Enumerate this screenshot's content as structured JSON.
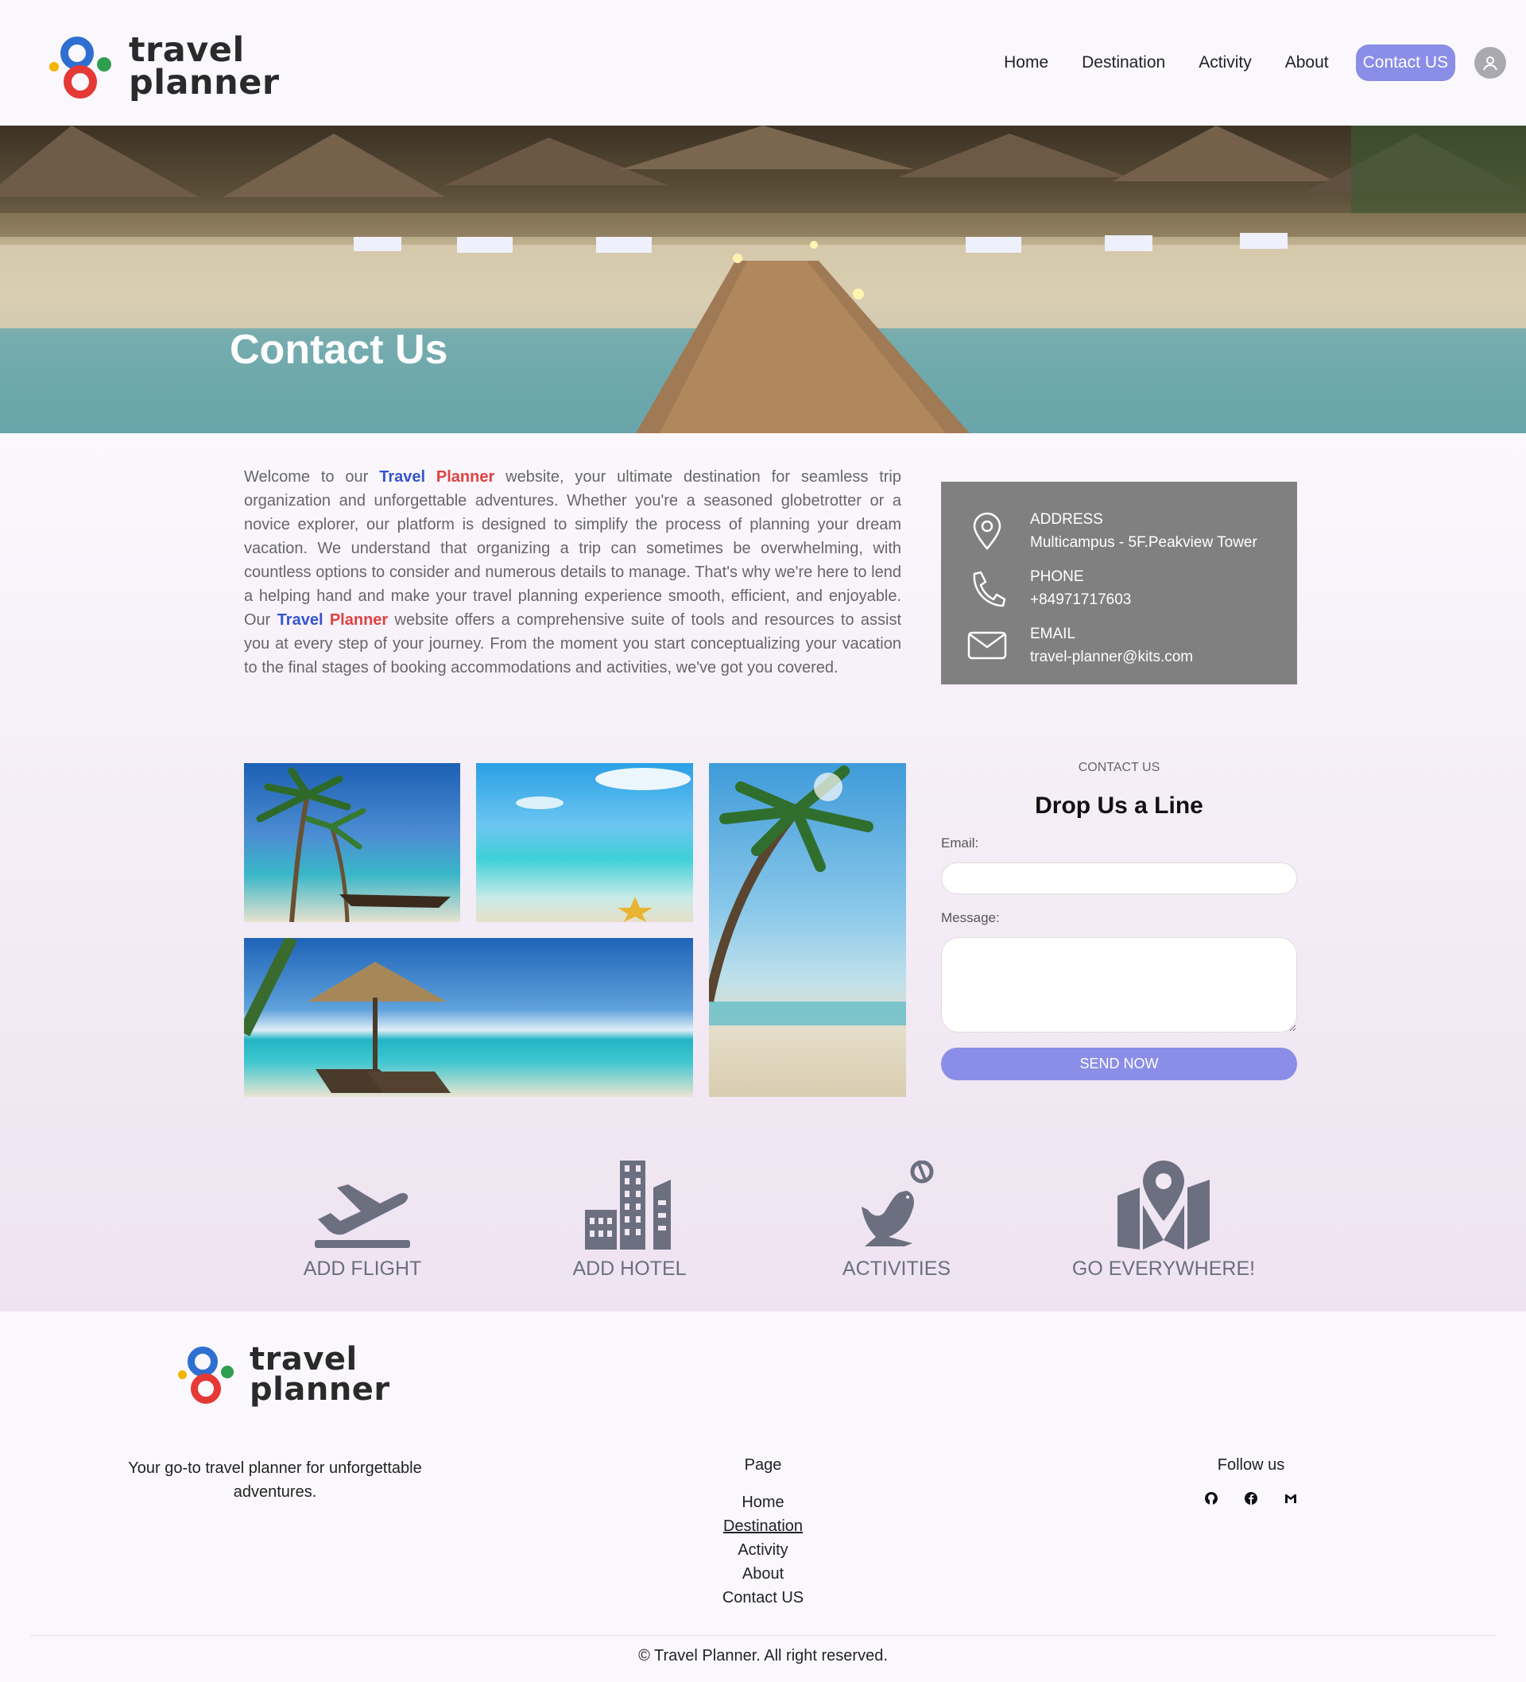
{
  "header": {
    "logo_line1": "travel",
    "logo_line2": "planner",
    "nav": [
      "Home",
      "Destination",
      "Activity",
      "About"
    ],
    "cta": "Contact US",
    "avatar_icon": "user-icon"
  },
  "hero": {
    "title": "Contact Us"
  },
  "intro": {
    "brand_a": "Travel",
    "brand_b": "Planner",
    "p1": "Welcome to our",
    "p2": "website, your ultimate destination for seamless trip organization and unforgettable adventures. Whether you're a seasoned globetrotter or a novice explorer, our platform is designed to simplify the process of planning your dream vacation. We understand that organizing a trip can sometimes be overwhelming, with countless options to consider and numerous details to manage. That's why we're here to lend a helping hand and make your travel planning experience smooth, efficient, and enjoyable. Our",
    "p3": "website offers a comprehensive suite of tools and resources to assist you at every step of your journey. From the moment you start conceptualizing your vacation to the final stages of booking accommodations and activities, we've got you covered."
  },
  "contact_info": {
    "address_label": "ADDRESS",
    "address_value": "Multicampus - 5F.Peakview Tower",
    "phone_label": "PHONE",
    "phone_value": "+84971717603",
    "email_label": "EMAIL",
    "email_value": "travel-planner@kits.com"
  },
  "form": {
    "kicker": "CONTACT US",
    "title": "Drop Us a Line",
    "email_label": "Email:",
    "message_label": "Message:",
    "submit": "SEND NOW"
  },
  "features": [
    {
      "label": "ADD FLIGHT",
      "icon": "plane-takeoff-icon"
    },
    {
      "label": "ADD HOTEL",
      "icon": "hotel-building-icon"
    },
    {
      "label": "ACTIVITIES",
      "icon": "seal-ball-icon"
    },
    {
      "label": "GO EVERYWHERE!",
      "icon": "map-pin-icon"
    }
  ],
  "footer": {
    "logo_line1": "travel",
    "logo_line2": "planner",
    "tagline": "Your go-to travel planner for unforgettable adventures.",
    "pages_heading": "Page",
    "pages": [
      "Home",
      "Destination",
      "Activity",
      "About",
      "Contact US"
    ],
    "follow_heading": "Follow us",
    "socials": [
      "github-icon",
      "facebook-icon",
      "gmail-icon"
    ],
    "copyright": "© Travel Planner. All right reserved."
  },
  "colors": {
    "accent": "#8a8ee6",
    "brand_blue": "#3355d0",
    "brand_red": "#e04141",
    "card_gray": "#808080",
    "feature_gray": "#6b6f80"
  }
}
